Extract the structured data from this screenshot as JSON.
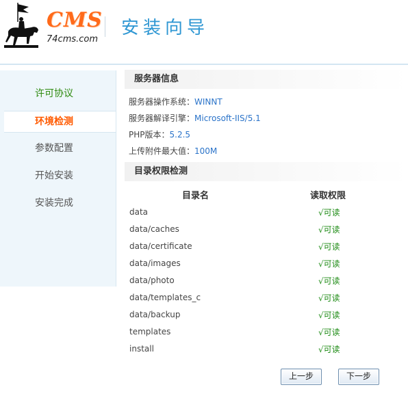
{
  "header": {
    "logo_text": "CMS",
    "logo_url": "74cms.com",
    "title": "安装向导"
  },
  "sidebar": {
    "items": [
      {
        "label": "许可协议",
        "state": "done"
      },
      {
        "label": "环境检测",
        "state": "active"
      },
      {
        "label": "参数配置",
        "state": "pending"
      },
      {
        "label": "开始安装",
        "state": "pending"
      },
      {
        "label": "安装完成",
        "state": "pending"
      }
    ]
  },
  "server_info": {
    "title": "服务器信息",
    "rows": [
      {
        "label": "服务器操作系统：",
        "value": "WINNT"
      },
      {
        "label": "服务器解译引擎：",
        "value": "Microsoft-IIS/5.1"
      },
      {
        "label": "PHP版本：",
        "value": "5.2.5"
      },
      {
        "label": "上传附件最大值：",
        "value": "100M"
      }
    ]
  },
  "dir_check": {
    "title": "目录权限检测",
    "col_name": "目录名",
    "col_perm": "读取权限",
    "rows": [
      {
        "name": "data",
        "perm": "√可读"
      },
      {
        "name": "data/caches",
        "perm": "√可读"
      },
      {
        "name": "data/certificate",
        "perm": "√可读"
      },
      {
        "name": "data/images",
        "perm": "√可读"
      },
      {
        "name": "data/photo",
        "perm": "√可读"
      },
      {
        "name": "data/templates_c",
        "perm": "√可读"
      },
      {
        "name": "data/backup",
        "perm": "√可读"
      },
      {
        "name": "templates",
        "perm": "√可读"
      },
      {
        "name": "install",
        "perm": "√可读"
      }
    ]
  },
  "buttons": {
    "prev": "上一步",
    "next": "下一步"
  },
  "colors": {
    "accent": "#2f97d3",
    "active": "#ff5a00",
    "done": "#2d8a0e",
    "ok": "#1c8a13",
    "value": "#2a73c9"
  }
}
